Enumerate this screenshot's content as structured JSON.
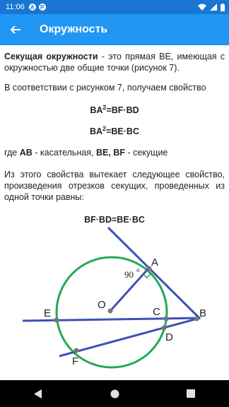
{
  "status_bar": {
    "time": "11:06",
    "icon1_letter": "A",
    "icon2_letter": "P"
  },
  "app_bar": {
    "title": "Окружность"
  },
  "content": {
    "p1_term": "Секущая окружности",
    "p1_rest": " - это прямая BE, имеющая с окружностью две общие точки (рисунок 7).",
    "p2": "В соответствии с рисунком 7, получаем свойство",
    "formula1_base": "BA",
    "formula1_sup": "2",
    "formula1_rest": "=BF·BD",
    "formula2_base": "BA",
    "formula2_sup": "2",
    "formula2_rest": "=BE·BC",
    "p3_prefix": "где ",
    "p3_ab": "AB",
    "p3_mid": " - касательная, ",
    "p3_be_bf": "BE, BF",
    "p3_suffix": " - секущие",
    "p4": "Из этого свойства вытекает следующее свойство, произведения отрезков секущих, проведенных из одной точки равны:",
    "formula3": "BF·BD=BE·BC"
  },
  "figure": {
    "labels": {
      "A": "A",
      "O": "O",
      "E": "E",
      "C": "C",
      "B": "B",
      "D": "D",
      "F": "F",
      "angle": "90",
      "angle_mark": "o"
    },
    "colors": {
      "circle": "#22AA55",
      "lines": "#3F51B5",
      "radius": "#3F51B5",
      "points": "#777777",
      "right_angle": "#22AA55"
    }
  },
  "colors": {
    "status_bar": "#1976D2",
    "app_bar": "#2196F3",
    "nav_bar": "#000000"
  },
  "icons": {
    "back": "arrow-back-icon",
    "nav_back": "triangle-back-icon",
    "nav_home": "circle-home-icon",
    "nav_recents": "square-recents-icon"
  }
}
